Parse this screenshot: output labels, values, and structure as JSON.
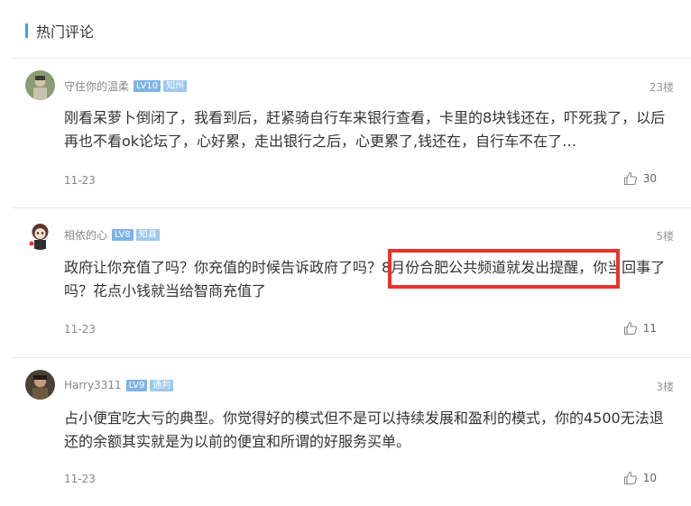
{
  "section": {
    "title": "热门评论"
  },
  "comments": [
    {
      "username": "守住你的温柔",
      "level": "LV10",
      "title": "知州",
      "floor": "23楼",
      "text": "刚看呆萝卜倒闭了，我看到后，赶紧骑自行车来银行查看，卡里的8块钱还在，吓死我了，以后再也不看ok论坛了，心好累，走出银行之后，心更累了,钱还在，自行车不在了…",
      "date": "11-23",
      "likes": "30",
      "avatar_color": "#8a9a72"
    },
    {
      "username": "相依的心",
      "level": "LV8",
      "title": "知县",
      "floor": "5楼",
      "text": "政府让你充值了吗？你充值的时候告诉政府了吗？8月份合肥公共频道就发出提醒，你当回事了吗？花点小钱就当给智商充值了",
      "date": "11-23",
      "likes": "11",
      "avatar_color": "#c9b6a6"
    },
    {
      "username": "Harry3311",
      "level": "LV9",
      "title": "通判",
      "floor": "3楼",
      "text": "占小便宜吃大亏的典型。你觉得好的模式但不是可以持续发展和盈利的模式，你的4500无法退还的余额其实就是为以前的便宜和所谓的好服务买单。",
      "date": "11-23",
      "likes": "10",
      "avatar_color": "#4a4036"
    }
  ],
  "colors": {
    "accent": "#3aa0e8",
    "highlight": "#e8332d"
  },
  "icons": {
    "like": "thumbs-up-icon"
  }
}
